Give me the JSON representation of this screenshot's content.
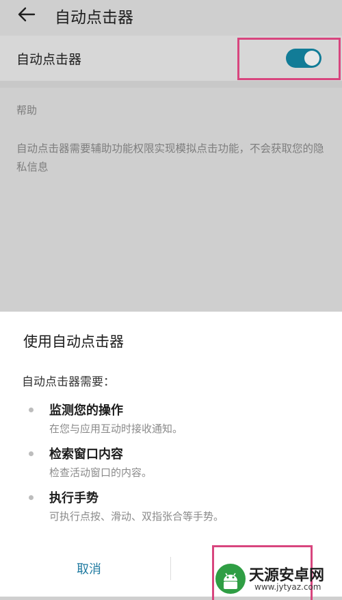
{
  "header": {
    "back_icon": "arrow-left-icon",
    "title": "自动点击器"
  },
  "setting": {
    "label": "自动点击器",
    "toggle_on": true,
    "accent": "#127c97"
  },
  "help": {
    "title": "帮助",
    "body": "自动点击器需要辅助功能权限实现模拟点击功能，不会获取您的隐私信息"
  },
  "dialog": {
    "title": "使用自动点击器",
    "intro": "自动点击器需要：",
    "permissions": [
      {
        "title": "监测您的操作",
        "desc": "在您与应用互动时接收通知。"
      },
      {
        "title": "检索窗口内容",
        "desc": "检查活动窗口的内容。"
      },
      {
        "title": "执行手势",
        "desc": "可执行点按、滑动、双指张合等手势。"
      }
    ],
    "cancel_label": "取消"
  },
  "highlight_color": "#d8457e",
  "watermark": {
    "name": "天源安卓网",
    "url": "www.jytyaz.com",
    "logo_icon": "android-logo-icon"
  }
}
